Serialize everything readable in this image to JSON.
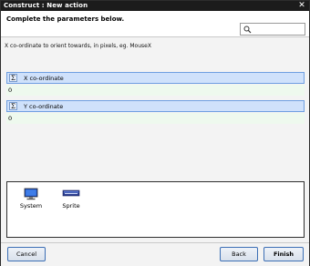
{
  "window": {
    "title": "Construct : New action",
    "close_glyph": "✕"
  },
  "header": {
    "heading": "Complete the parameters below.",
    "search_placeholder": ""
  },
  "description": "X co-ordinate to orient towards, in pixels, eg. MouseX",
  "params": [
    {
      "label": "X co-ordinate",
      "value": "0",
      "icon": "sigma-icon"
    },
    {
      "label": "Y co-ordinate",
      "value": "0",
      "icon": "sigma-icon"
    }
  ],
  "objects": [
    {
      "name": "System",
      "icon": "monitor-icon"
    },
    {
      "name": "Sprite",
      "icon": "sprite-icon"
    }
  ],
  "footer": {
    "cancel": "Cancel",
    "back": "Back",
    "finish": "Finish"
  },
  "colors": {
    "titlebar": "#1c1c1c",
    "param_header": "#cfe1fb",
    "param_field": "#eef9ee",
    "button_border": "#3c6fb5"
  }
}
